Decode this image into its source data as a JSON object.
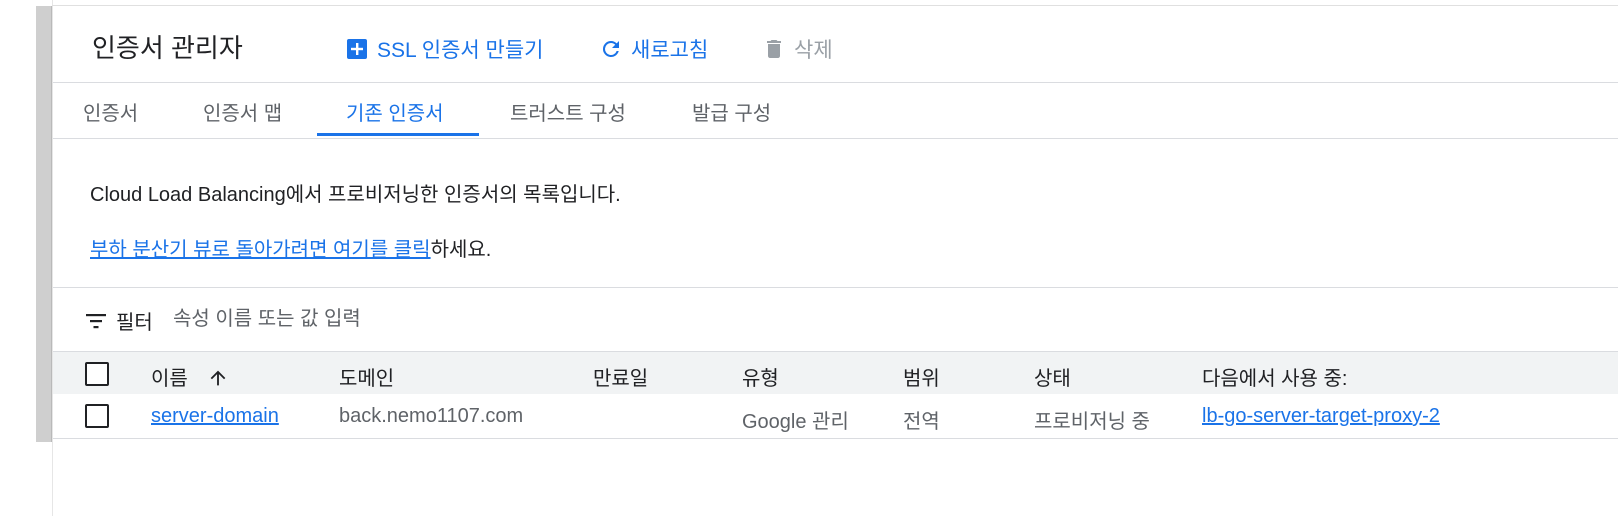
{
  "header": {
    "title": "인증서 관리자",
    "actions": {
      "create": "SSL 인증서 만들기",
      "refresh": "새로고침",
      "delete": "삭제"
    }
  },
  "tabs": [
    {
      "label": "인증서",
      "active": false
    },
    {
      "label": "인증서 맵",
      "active": false
    },
    {
      "label": "기존 인증서",
      "active": true
    },
    {
      "label": "트러스트 구성",
      "active": false
    },
    {
      "label": "발급 구성",
      "active": false
    }
  ],
  "content": {
    "description": "Cloud Load Balancing에서 프로비저닝한 인증서의 목록입니다.",
    "link_text": "부하 분산기 뷰로 돌아가려면 여기를 클릭",
    "link_suffix": "하세요."
  },
  "filter": {
    "label": "필터",
    "placeholder": "속성 이름 또는 값 입력"
  },
  "table": {
    "columns": [
      "이름",
      "도메인",
      "만료일",
      "유형",
      "범위",
      "상태",
      "다음에서 사용 중:"
    ],
    "sorted_column": "이름",
    "sort_direction": "ascending",
    "rows": [
      {
        "name": "server-domain",
        "domain": "back.nemo1107.com",
        "expiry": "",
        "type": "Google 관리",
        "scope": "전역",
        "status": "프로비저닝 중",
        "used_by": "lb-go-server-target-proxy-2"
      }
    ]
  },
  "colors": {
    "accent": "#1a73e8",
    "text_primary": "#202124",
    "text_secondary": "#5f6368",
    "disabled": "#9aa0a6",
    "header_bg": "#f1f3f4",
    "divider": "#dadce0"
  }
}
